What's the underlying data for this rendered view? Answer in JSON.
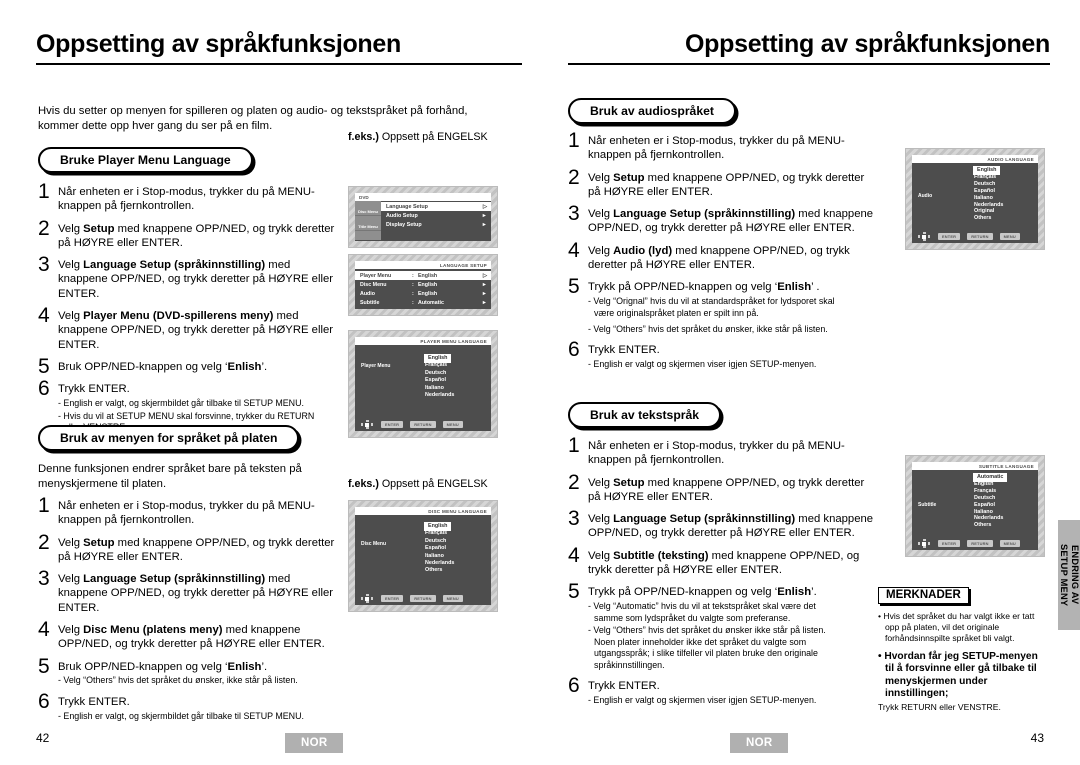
{
  "left_page": {
    "title": "Oppsetting av språkfunksjonen",
    "intro": "Hvis du setter op menyen for spilleren og platen og audio- og tekstspråket på forhånd, kommer dette opp hver gang du ser på en film.",
    "page_number": "42",
    "locale_badge": "NOR",
    "section1": {
      "heading": "Bruke Player Menu Language",
      "steps": [
        {
          "num": "1",
          "text": "Når enheten er i Stop-modus, trykker du på MENU-knappen på fjernkontrollen."
        },
        {
          "num": "2",
          "text_before": "Velg ",
          "bold": "Setup",
          "text_after": " med knappene OPP/NED, og trykk deretter på HØYRE eller ENTER."
        },
        {
          "num": "3",
          "text_before": "Velg ",
          "bold": "Language Setup (språkinnstilling)",
          "text_after": " med knappene OPP/NED, og trykk deretter på HØYRE eller ENTER."
        },
        {
          "num": "4",
          "text_before": "Velg ",
          "bold": "Player Menu (DVD-spillerens meny)",
          "text_after": " med knappene OPP/NED, og trykk deretter på HØYRE eller ENTER."
        },
        {
          "num": "5",
          "text_before": "Bruk OPP/NED-knappen og velg ‘",
          "bold": "Enlish",
          "text_after": "’."
        },
        {
          "num": "6",
          "text": "Trykk ENTER.",
          "notes": [
            "- English er valgt, og skjermbildet går tilbake til SETUP MENU.",
            "- Hvis du vil at SETUP MENU skal forsvinne, trykker du RETURN",
            "eller VENSTRE."
          ]
        }
      ]
    },
    "section2": {
      "heading": "Bruk av menyen for språket på platen",
      "paragraph": "Denne funksjonen endrer språket bare på teksten på menyskjermene til platen.",
      "steps": [
        {
          "num": "1",
          "text": "Når enheten er i Stop-modus, trykker du på MENU-knappen på fjernkontrollen."
        },
        {
          "num": "2",
          "text_before": "Velg ",
          "bold": "Setup",
          "text_after": " med knappene OPP/NED, og trykk deretter på HØYRE eller ENTER."
        },
        {
          "num": "3",
          "text_before": "Velg ",
          "bold": "Language Setup (språkinnstilling)",
          "text_after": " med knappene OPP/NED, og trykk deretter på HØYRE eller ENTER."
        },
        {
          "num": "4",
          "text_before": "Velg ",
          "bold": "Disc Menu (platens meny)",
          "text_after": " med knappene OPP/NED, og trykk deretter på HØYRE eller ENTER."
        },
        {
          "num": "5",
          "text_before": "Bruk OPP/NED-knappen og velg ‘",
          "bold": "Enlish",
          "text_after": "’.",
          "notes": [
            "- Velg “Others” hvis det språket du ønsker, ikke står på listen."
          ]
        },
        {
          "num": "6",
          "text": "Trykk ENTER.",
          "notes": [
            "- English er valgt, og skjermbildet går tilbake til SETUP MENU."
          ]
        }
      ]
    },
    "caption1": {
      "bold": "f.eks.)",
      "rest": " Oppsett på ENGELSK"
    },
    "caption2": {
      "bold": "f.eks.)",
      "rest": " Oppsett på ENGELSK"
    }
  },
  "right_page": {
    "title": "Oppsetting av språkfunksjonen",
    "page_number": "43",
    "locale_badge": "NOR",
    "side_tab": "ENDRING AV\nSETUP MENY",
    "section3": {
      "heading": "Bruk av audiospråket",
      "steps": [
        {
          "num": "1",
          "text": "Når enheten er i Stop-modus, trykker du på MENU-knappen på fjernkontrollen."
        },
        {
          "num": "2",
          "text_before": "Velg ",
          "bold": "Setup",
          "text_after": " med knappene OPP/NED, og trykk deretter på HØYRE eller ENTER."
        },
        {
          "num": "3",
          "text_before": "Velg ",
          "bold": "Language Setup (språkinnstilling)",
          "text_after": " med knappene OPP/NED, og trykk deretter på HØYRE eller ENTER."
        },
        {
          "num": "4",
          "text_before": "Velg ",
          "bold": "Audio (lyd)",
          "text_after": " med knappene OPP/NED, og trykk deretter på HØYRE eller ENTER."
        },
        {
          "num": "5",
          "text_before": "Trykk på OPP/NED-knappen og velg ‘",
          "bold": "Enlish",
          "text_after": "’ .",
          "notes": [
            "- Velg “Orignal” hvis du vil at standardspråket for  lydsporet skal",
            "være originalspråket platen er spilt inn på.",
            "- Velg “Others” hvis det språket du ønsker, ikke står på listen."
          ]
        },
        {
          "num": "6",
          "text": "Trykk ENTER.",
          "notes": [
            "- English er valgt og skjermen viser igjen SETUP-menyen."
          ]
        }
      ]
    },
    "section4": {
      "heading": "Bruk av tekstspråk",
      "steps": [
        {
          "num": "1",
          "text": "Når enheten er i Stop-modus, trykker du på MENU-knappen på fjernkontrollen."
        },
        {
          "num": "2",
          "text_before": "Velg ",
          "bold": "Setup",
          "text_after": " med knappene OPP/NED, og trykk deretter på HØYRE eller ENTER."
        },
        {
          "num": "3",
          "text_before": "Velg ",
          "bold": "Language Setup (språkinnstilling)",
          "text_after": " med knappene OPP/NED, og trykk deretter på HØYRE eller ENTER."
        },
        {
          "num": "4",
          "text_before": "Velg ",
          "bold": "Subtitle (teksting)",
          "text_after": " med knappene OPP/NED, og trykk deretter på HØYRE eller ENTER."
        },
        {
          "num": "5",
          "text_before": "Trykk på OPP/NED-knappen og velg ‘",
          "bold": "Enlish",
          "text_after": "’.",
          "notes": [
            "- Velg “Automatic” hvis du vil at tekstspråket skal være det",
            "samme som lydspråket du valgte som preferanse.",
            "- Velg “Others” hvis det språket du ønsker ikke står på listen.",
            "Noen plater inneholder ikke det språket du valgte som",
            "utgangsspråk; i slike tilfeller vil platen bruke den originale",
            "språkinnstillingen."
          ]
        },
        {
          "num": "6",
          "text": "Trykk ENTER.",
          "notes": [
            "- English er valgt og skjermen viser igjen SETUP-menyen."
          ]
        }
      ]
    },
    "merknader": {
      "title": "MERKNADER",
      "item1": "• Hvis det språket du har valgt ikke er tatt opp på platen, vil det originale forhåndsinnspilte språket bli valgt.",
      "item2": "• Hvordan får jeg SETUP-menyen til å forsvinne eller gå tilbake til menyskjermen under innstillingen;",
      "item2_sub": "Trykk RETURN eller VENSTRE."
    }
  },
  "screens": {
    "dvd_setup": {
      "top_label": "DVD",
      "side_items": [
        "Disc Menu",
        "Title Menu"
      ],
      "rows": [
        {
          "label": "Language Setup",
          "selected": true
        },
        {
          "label": "Audio Setup",
          "selected": false
        },
        {
          "label": "Display Setup",
          "selected": false
        }
      ]
    },
    "language_setup": {
      "title": "LANGUAGE SETUP",
      "rows": [
        {
          "label": "Player Menu",
          "value": "English",
          "selected": true
        },
        {
          "label": "Disc Menu",
          "value": "English",
          "selected": false
        },
        {
          "label": "Audio",
          "value": "English",
          "selected": false
        },
        {
          "label": "Subtitle",
          "value": "Automatic",
          "selected": false
        }
      ]
    },
    "player_menu_language": {
      "title": "PLAYER MENU LANGUAGE",
      "label": "Player Menu",
      "options": [
        "English",
        "Français",
        "Deutsch",
        "Español",
        "Italiano",
        "Nederlands"
      ],
      "selected": "English",
      "keys": [
        "ENTER",
        "RETURN",
        "MENU"
      ]
    },
    "disc_menu_language": {
      "title": "DISC MENU LANGUAGE",
      "label": "Disc Menu",
      "options": [
        "English",
        "Français",
        "Deutsch",
        "Español",
        "Italiano",
        "Nederlands",
        "Others"
      ],
      "selected": "English",
      "keys": [
        "ENTER",
        "RETURN",
        "MENU"
      ]
    },
    "audio_language": {
      "title": "AUDIO LANGUAGE",
      "label": "Audio",
      "options": [
        "English",
        "Français",
        "Deutsch",
        "Español",
        "Italiano",
        "Nederlands",
        "Original",
        "Others"
      ],
      "selected": "English",
      "keys": [
        "ENTER",
        "RETURN",
        "MENU"
      ]
    },
    "subtitle_language": {
      "title": "SUBTITLE LANGUAGE",
      "label": "Subtitle",
      "options": [
        "Automatic",
        "English",
        "Français",
        "Deutsch",
        "Español",
        "Italiano",
        "Nederlands",
        "Others"
      ],
      "selected": "Automatic",
      "keys": [
        "ENTER",
        "RETURN",
        "MENU"
      ]
    }
  }
}
